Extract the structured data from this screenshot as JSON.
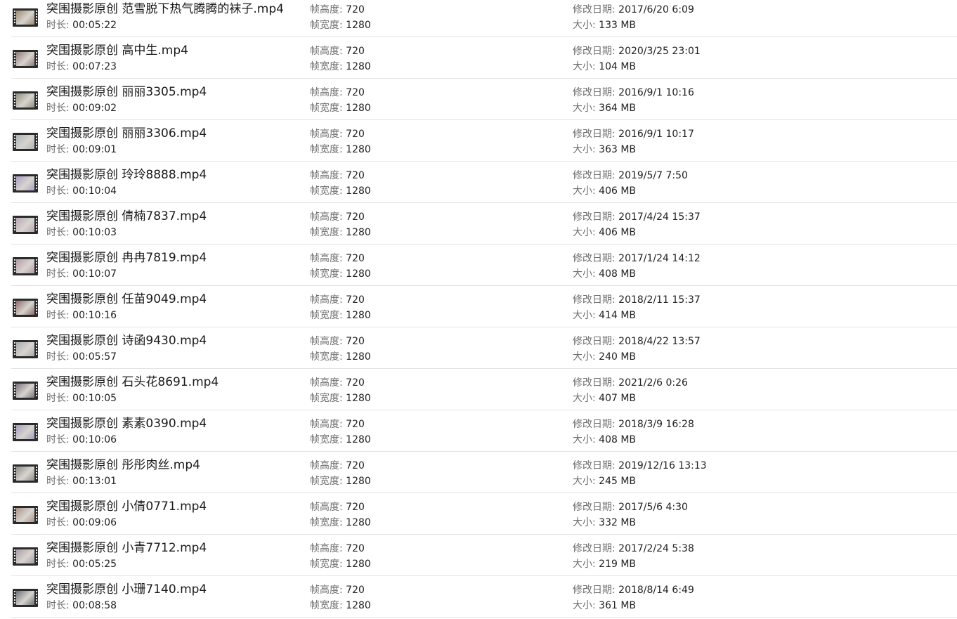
{
  "labels": {
    "duration": "时长:",
    "frame_height": "帧高度:",
    "frame_width": "帧宽度:",
    "modified": "修改日期:",
    "size": "大小:"
  },
  "files": [
    {
      "name": "突围摄影原创 范雪脱下热气腾腾的袜子.mp4",
      "duration": "00:05:22",
      "frame_height": "720",
      "frame_width": "1280",
      "modified": "2017/6/20 6:09",
      "size": "133 MB",
      "thumb_color": "#9a8a70"
    },
    {
      "name": "突围摄影原创 高中生.mp4",
      "duration": "00:07:23",
      "frame_height": "720",
      "frame_width": "1280",
      "modified": "2020/3/25 23:01",
      "size": "104 MB",
      "thumb_color": "#8c7a78"
    },
    {
      "name": "突围摄影原创 丽丽3305.mp4",
      "duration": "00:09:02",
      "frame_height": "720",
      "frame_width": "1280",
      "modified": "2016/9/1 10:16",
      "size": "364 MB",
      "thumb_color": "#8f9080"
    },
    {
      "name": "突围摄影原创 丽丽3306.mp4",
      "duration": "00:09:01",
      "frame_height": "720",
      "frame_width": "1280",
      "modified": "2016/9/1 10:17",
      "size": "363 MB",
      "thumb_color": "#aab4b6"
    },
    {
      "name": "突围摄影原创 玲玲8888.mp4",
      "duration": "00:10:04",
      "frame_height": "720",
      "frame_width": "1280",
      "modified": "2019/5/7 7:50",
      "size": "406 MB",
      "thumb_color": "#a6a0c0"
    },
    {
      "name": "突围摄影原创 倩楠7837.mp4",
      "duration": "00:10:03",
      "frame_height": "720",
      "frame_width": "1280",
      "modified": "2017/4/24 15:37",
      "size": "406 MB",
      "thumb_color": "#b8a8b4"
    },
    {
      "name": "突围摄影原创 冉冉7819.mp4",
      "duration": "00:10:07",
      "frame_height": "720",
      "frame_width": "1280",
      "modified": "2017/1/24 14:12",
      "size": "408 MB",
      "thumb_color": "#b49aa6"
    },
    {
      "name": "突围摄影原创 任苗9049.mp4",
      "duration": "00:10:16",
      "frame_height": "720",
      "frame_width": "1280",
      "modified": "2018/2/11 15:37",
      "size": "414 MB",
      "thumb_color": "#8a6a66"
    },
    {
      "name": "突围摄影原创 诗函9430.mp4",
      "duration": "00:05:57",
      "frame_height": "720",
      "frame_width": "1280",
      "modified": "2018/4/22 13:57",
      "size": "240 MB",
      "thumb_color": "#a8aab0"
    },
    {
      "name": "突围摄影原创 石头花8691.mp4",
      "duration": "00:10:05",
      "frame_height": "720",
      "frame_width": "1280",
      "modified": "2021/2/6 0:26",
      "size": "407 MB",
      "thumb_color": "#7c7480"
    },
    {
      "name": "突围摄影原创 素素0390.mp4",
      "duration": "00:10:06",
      "frame_height": "720",
      "frame_width": "1280",
      "modified": "2018/3/9 16:28",
      "size": "408 MB",
      "thumb_color": "#a49cc0"
    },
    {
      "name": "突围摄影原创 彤彤肉丝.mp4",
      "duration": "00:13:01",
      "frame_height": "720",
      "frame_width": "1280",
      "modified": "2019/12/16 13:13",
      "size": "245 MB",
      "thumb_color": "#8e8a84"
    },
    {
      "name": "突围摄影原创 小倩0771.mp4",
      "duration": "00:09:06",
      "frame_height": "720",
      "frame_width": "1280",
      "modified": "2017/5/6 4:30",
      "size": "332 MB",
      "thumb_color": "#a89488"
    },
    {
      "name": "突围摄影原创 小青7712.mp4",
      "duration": "00:05:25",
      "frame_height": "720",
      "frame_width": "1280",
      "modified": "2017/2/24 5:38",
      "size": "219 MB",
      "thumb_color": "#a89ca8"
    },
    {
      "name": "突围摄影原创 小珊7140.mp4",
      "duration": "00:08:58",
      "frame_height": "720",
      "frame_width": "1280",
      "modified": "2018/8/14 6:49",
      "size": "361 MB",
      "thumb_color": "#6e7078"
    }
  ]
}
